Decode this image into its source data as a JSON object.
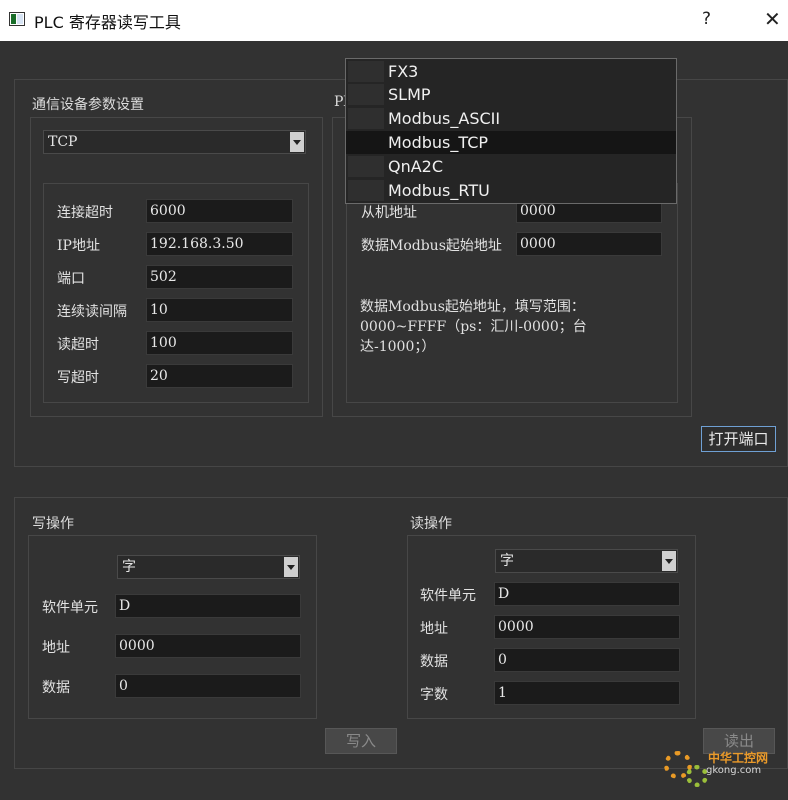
{
  "window": {
    "title": "PLC 寄存器读写工具",
    "help": "?",
    "close": "✕"
  },
  "comm": {
    "heading": "通信设备参数设置",
    "mode": "TCP",
    "fields": [
      {
        "label": "连接超时",
        "value": "6000"
      },
      {
        "label": "IP地址",
        "value": "192.168.3.50"
      },
      {
        "label": "端口",
        "value": "502"
      },
      {
        "label": "连续读间隔",
        "value": "10"
      },
      {
        "label": "读超时",
        "value": "100"
      },
      {
        "label": "写超时",
        "value": "20"
      }
    ]
  },
  "plc": {
    "heading": "Pl",
    "slave_label": "从机地址",
    "slave_value": "0000",
    "start_label": "数据Modbus起始地址",
    "start_value": "0000",
    "description": [
      "数据Modbus起始地址，填写范围：",
      "0000~FFFF（ps：汇川-0000；台",
      "达-1000；）"
    ]
  },
  "protocol_dropdown": {
    "options": [
      "FX3",
      "SLMP",
      "Modbus_ASCII",
      "Modbus_TCP",
      "QnA2C",
      "Modbus_RTU"
    ],
    "selected": "Modbus_TCP"
  },
  "buttons": {
    "open_port": "打开端口",
    "write": "写入",
    "read": "读出"
  },
  "write_op": {
    "heading": "写操作",
    "type": "字",
    "fields": [
      {
        "label": "软件单元",
        "value": "D"
      },
      {
        "label": "地址",
        "value": "0000"
      },
      {
        "label": "数据",
        "value": "0"
      }
    ]
  },
  "read_op": {
    "heading": "读操作",
    "type": "字",
    "fields": [
      {
        "label": "软件单元",
        "value": "D"
      },
      {
        "label": "地址",
        "value": "0000"
      },
      {
        "label": "数据",
        "value": "0"
      },
      {
        "label": "字数",
        "value": "1"
      }
    ]
  },
  "watermark": {
    "text": "中华工控网",
    "sub": "gkong.com"
  },
  "colors": {
    "background": "#323232",
    "field": "#1b1b1b",
    "accent_border": "#6fa0d4",
    "watermark": "#e99a26"
  }
}
